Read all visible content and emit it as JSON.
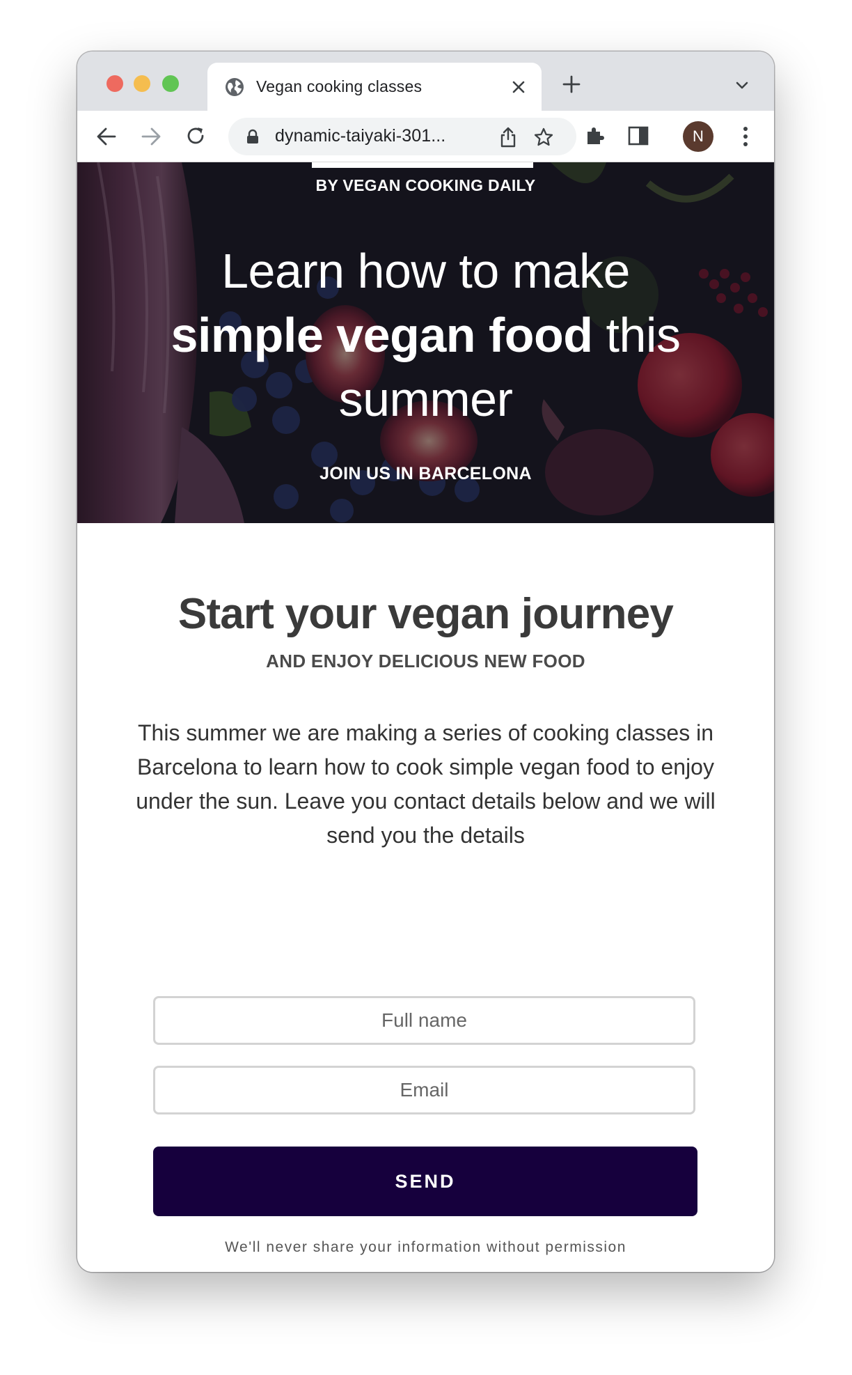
{
  "browser": {
    "tab": {
      "title": "Vegan cooking classes"
    },
    "address": {
      "url": "dynamic-taiyaki-301..."
    },
    "profile": {
      "initial": "N"
    }
  },
  "hero": {
    "byline": "BY VEGAN COOKING DAILY",
    "headline_line1": "Learn how to make",
    "headline_bold": "simple vegan food",
    "headline_after_bold": " this",
    "headline_line3": "summer",
    "cta": "JOIN US IN BARCELONA"
  },
  "main": {
    "title": "Start your vegan journey",
    "subtitle": "AND ENJOY DELICIOUS NEW FOOD",
    "description": "This summer we are making a series of cooking classes in Barcelona to learn how to cook simple vegan food to enjoy under the sun. Leave you contact details below and we will send you the details"
  },
  "form": {
    "name_placeholder": "Full name",
    "email_placeholder": "Email",
    "send_label": "SEND",
    "privacy_note": "We'll never share your information without permission"
  },
  "colors": {
    "button": "#16003d",
    "heading": "#3a3a3a",
    "hero_overlay": "#14121c"
  }
}
